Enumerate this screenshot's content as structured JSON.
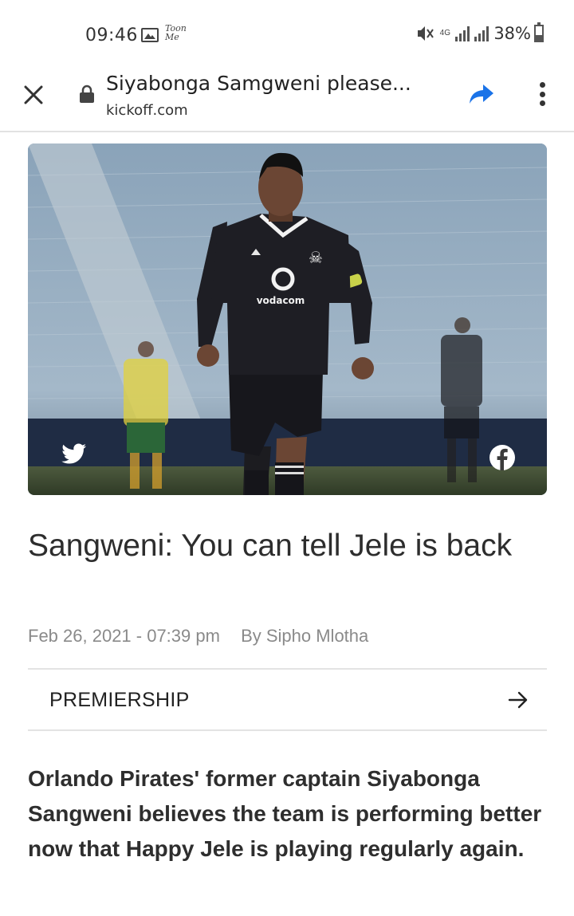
{
  "status_bar": {
    "time": "09:46",
    "toon_label": "Toon Me",
    "network_label": "4G",
    "battery_percent": "38%",
    "battery_level": 0.38
  },
  "browser": {
    "page_title": "Siyabonga Samgweni please...",
    "domain": "kickoff.com",
    "accent_color": "#1a73e8"
  },
  "hero": {
    "jersey_sponsor": "vodacom",
    "icons": [
      "twitter-icon",
      "facebook-icon"
    ]
  },
  "article": {
    "headline": "Sangweni: You can tell Jele is back",
    "date": "Feb 26, 2021 - 07:39 pm",
    "author": "By Sipho Mlotha",
    "category": "PREMIERSHIP",
    "lead": "Orlando Pirates' former captain Siyabonga Sangweni believes the team is performing better now that Happy Jele is playing regularly again."
  }
}
